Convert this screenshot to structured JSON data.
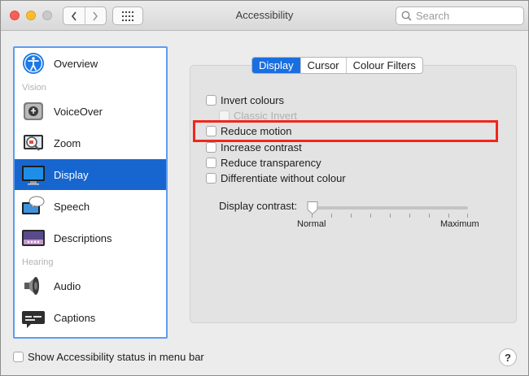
{
  "window": {
    "title": "Accessibility",
    "search_placeholder": "Search"
  },
  "sidebar": {
    "sections": {
      "vision": "Vision",
      "hearing": "Hearing"
    },
    "items": [
      {
        "label": "Overview",
        "icon": "accessibility-person-icon"
      },
      {
        "label": "VoiceOver",
        "icon": "voiceover-icon"
      },
      {
        "label": "Zoom",
        "icon": "zoom-icon"
      },
      {
        "label": "Display",
        "icon": "display-icon",
        "selected": true
      },
      {
        "label": "Speech",
        "icon": "speech-icon"
      },
      {
        "label": "Descriptions",
        "icon": "descriptions-icon"
      },
      {
        "label": "Audio",
        "icon": "speaker-icon"
      },
      {
        "label": "Captions",
        "icon": "captions-icon"
      }
    ]
  },
  "tabs": [
    {
      "label": "Display",
      "selected": true
    },
    {
      "label": "Cursor",
      "selected": false
    },
    {
      "label": "Colour Filters",
      "selected": false
    }
  ],
  "options": {
    "invert_colours": {
      "label": "Invert colours",
      "checked": false
    },
    "classic_invert": {
      "label": "Classic Invert",
      "checked": false,
      "disabled": true
    },
    "reduce_motion": {
      "label": "Reduce motion",
      "checked": false
    },
    "increase_contrast": {
      "label": "Increase contrast",
      "checked": false
    },
    "reduce_transparency": {
      "label": "Reduce transparency",
      "checked": false
    },
    "differentiate_without_colour": {
      "label": "Differentiate without colour",
      "checked": false
    }
  },
  "display_contrast": {
    "label": "Display contrast:",
    "min_label": "Normal",
    "max_label": "Maximum",
    "value": 0
  },
  "footer": {
    "show_status_label": "Show Accessibility status in menu bar",
    "help_label": "?"
  },
  "colors": {
    "accent": "#1766cf",
    "highlight_box": "#f2261a"
  }
}
